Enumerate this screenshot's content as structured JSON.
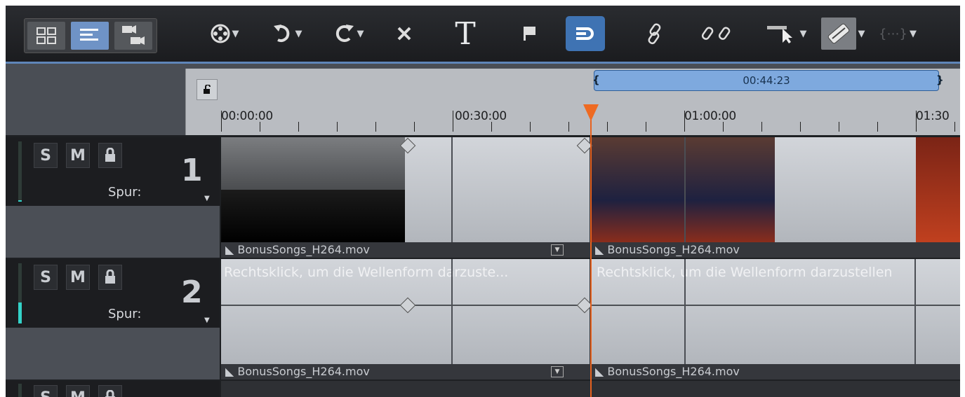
{
  "ruler": {
    "range_label": "00:44:23",
    "ticks": [
      "00:00:00",
      "00:30:00",
      "01:00:00",
      "01:30"
    ]
  },
  "tracks": [
    {
      "number": "1",
      "solo_label": "S",
      "mute_label": "M",
      "spur_label": "Spur:",
      "clips": [
        "BonusSongs_H264.mov",
        "BonusSongs_H264.mov"
      ]
    },
    {
      "number": "2",
      "solo_label": "S",
      "mute_label": "M",
      "spur_label": "Spur:",
      "waveform_hint_1": "Rechtsklick, um die Wellenform darzuste...",
      "waveform_hint_2": "Rechtsklick, um die Wellenform darzustellen",
      "clips": [
        "BonusSongs_H264.mov",
        "BonusSongs_H264.mov"
      ]
    },
    {
      "solo_label": "S",
      "mute_label": "M"
    }
  ],
  "toolbar": {
    "icons": [
      "storyboard-view-icon",
      "timeline-view-icon",
      "multicam-view-icon",
      "film-reel-icon",
      "undo-icon",
      "redo-icon",
      "delete-icon",
      "text-icon",
      "marker-flag-icon",
      "snap-icon",
      "link-icon",
      "unlink-icon",
      "mouse-mode-icon",
      "razor-icon",
      "group-icon"
    ]
  },
  "colors": {
    "accent_blue": "#3f73b3",
    "playhead": "#e7621f",
    "meter": "#33d2c8"
  }
}
